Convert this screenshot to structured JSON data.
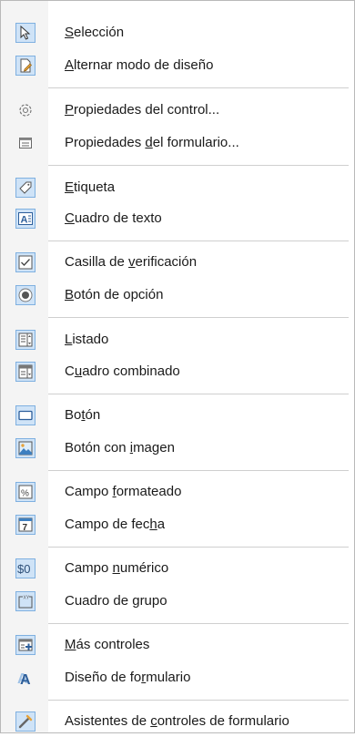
{
  "menu": {
    "items": [
      {
        "pre": "",
        "u": "S",
        "post": "elección",
        "icon": "select-arrow-icon"
      },
      {
        "pre": "",
        "u": "A",
        "post": "lternar modo de diseño",
        "icon": "design-mode-icon"
      },
      {
        "pre": "",
        "u": "P",
        "post": "ropiedades del control...",
        "icon": "control-properties-gear-icon"
      },
      {
        "pre": "Propiedades ",
        "u": "d",
        "post": "el formulario...",
        "icon": "form-properties-icon"
      },
      {
        "pre": "",
        "u": "E",
        "post": "tiqueta",
        "icon": "label-tag-icon"
      },
      {
        "pre": "",
        "u": "C",
        "post": "uadro de texto",
        "icon": "text-box-icon"
      },
      {
        "pre": "Casilla de ",
        "u": "v",
        "post": "erificación",
        "icon": "checkbox-icon"
      },
      {
        "pre": "",
        "u": "B",
        "post": "otón de opción",
        "icon": "radio-button-icon"
      },
      {
        "pre": "",
        "u": "L",
        "post": "istado",
        "icon": "list-box-icon"
      },
      {
        "pre": "C",
        "u": "u",
        "post": "adro combinado",
        "icon": "combo-box-icon"
      },
      {
        "pre": "Bo",
        "u": "t",
        "post": "ón",
        "icon": "push-button-icon"
      },
      {
        "pre": "Botón con ",
        "u": "i",
        "post": "magen",
        "icon": "image-button-icon"
      },
      {
        "pre": "Campo ",
        "u": "f",
        "post": "ormateado",
        "icon": "formatted-field-icon"
      },
      {
        "pre": "Campo de fec",
        "u": "h",
        "post": "a",
        "icon": "date-field-icon"
      },
      {
        "pre": "Campo ",
        "u": "n",
        "post": "umérico",
        "icon": "numeric-field-icon"
      },
      {
        "pre": "Cuadro de ",
        "u": "g",
        "post": "rupo",
        "icon": "group-box-icon"
      },
      {
        "pre": "",
        "u": "M",
        "post": "ás controles",
        "icon": "more-controls-icon"
      },
      {
        "pre": "Diseño de fo",
        "u": "r",
        "post": "mulario",
        "icon": "form-design-icon"
      },
      {
        "pre": "Asistentes de ",
        "u": "c",
        "post": "ontroles de formulario",
        "icon": "control-wizards-icon"
      }
    ],
    "digit": "7",
    "dollar": "$0",
    "percent": "%"
  }
}
